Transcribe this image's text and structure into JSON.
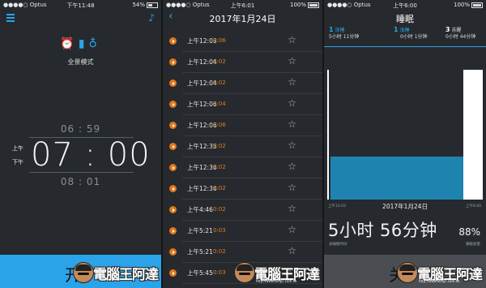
{
  "screen1": {
    "status": {
      "carrier": "●●●●○ Optus",
      "time": "下午11:48",
      "battery": "54%"
    },
    "mode_label": "全景模式",
    "alarm": {
      "ampm_am": "上午",
      "ampm_pm": "下午",
      "time": "07 : 00",
      "prev": "06 : 59",
      "next": "08 : 01"
    },
    "start_label": "开"
  },
  "screen2": {
    "status": {
      "carrier": "●●●●○ Optus",
      "time": "上午6:01",
      "battery": "100%"
    },
    "title": "2017年1月24日",
    "recordings": [
      {
        "time": "上午12:03",
        "duration": "0:06"
      },
      {
        "time": "上午12:04",
        "duration": "0:02"
      },
      {
        "time": "上午12:04",
        "duration": "0:02"
      },
      {
        "time": "上午12:06",
        "duration": "0:04"
      },
      {
        "time": "上午12:06",
        "duration": "0:06"
      },
      {
        "time": "上午12:35",
        "duration": "0:02"
      },
      {
        "time": "上午12:36",
        "duration": "0:02"
      },
      {
        "time": "上午12:36",
        "duration": "0:02"
      },
      {
        "time": "上午4:46",
        "duration": "0:02"
      },
      {
        "time": "上午5:21",
        "duration": "0:03"
      },
      {
        "time": "上午5:21",
        "duration": "0:02"
      },
      {
        "time": "上午5:45",
        "duration": "0:03"
      }
    ]
  },
  "screen3": {
    "status": {
      "carrier": "●●●●○ Optus",
      "time": "上午6:00",
      "battery": "100%"
    },
    "title": "睡眠",
    "stats": [
      {
        "count": "1",
        "name": "深睡",
        "value": "5小时 11分钟"
      },
      {
        "count": "1",
        "name": "浅睡",
        "value": "0小时 1分钟"
      },
      {
        "count": "3",
        "name": "苏醒",
        "value": "0小时 44分钟"
      }
    ],
    "chart_data": {
      "type": "area",
      "title": "",
      "xlabel": "2017年1月24日",
      "x_ticks": [
        "上午12:03",
        "上午6:00"
      ],
      "series": [
        {
          "name": "苏醒",
          "values": [
            1,
            0,
            0,
            0,
            1
          ]
        },
        {
          "name": "深睡",
          "values": [
            0,
            1,
            1,
            1,
            0
          ]
        }
      ],
      "colors": {
        "awake": "#ffffff",
        "deep": "#1f83b0"
      }
    },
    "total": "5小时 56分钟",
    "total_label": "总睡眠时间",
    "quality": "88%",
    "quality_label": "睡眠质量",
    "stop_label": "关"
  },
  "watermark": {
    "text": "電腦王阿達",
    "url": "http://www.kocpc.com.tw"
  },
  "colors": {
    "accent": "#2aa3e8",
    "orange": "#e07e20",
    "panel": "#262a2e"
  }
}
